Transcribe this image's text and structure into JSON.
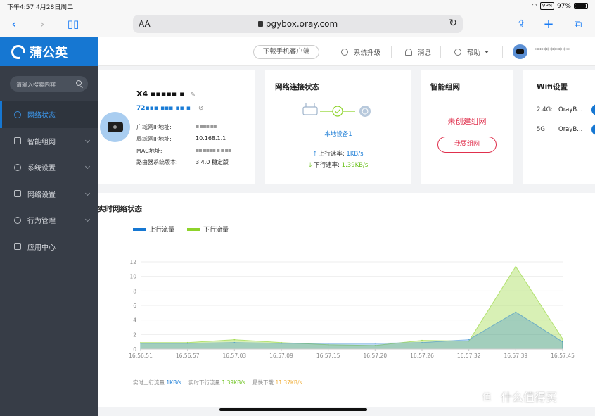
{
  "status_bar": {
    "time_date": "下午4:57   4月28日周二",
    "vpn": "VPN",
    "battery": "97%"
  },
  "browser": {
    "aa": "AA",
    "url": "pgybox.oray.com"
  },
  "sidebar": {
    "brand": "蒲公英",
    "search_placeholder": "请输入搜索内容",
    "items": [
      {
        "label": "网络状态",
        "active": true
      },
      {
        "label": "智能组网"
      },
      {
        "label": "系统设置"
      },
      {
        "label": "网络设置"
      },
      {
        "label": "行为管理"
      },
      {
        "label": "应用中心"
      }
    ]
  },
  "header": {
    "download": "下载手机客户端",
    "upgrade": "系统升级",
    "messages": "消息",
    "help": "帮助",
    "user": "*** ** ** ** * *"
  },
  "device_card": {
    "name": "X4 ▪▪▪▪▪ ▪",
    "id": "72▪▪▪ ▪▪▪ ▪▪ ▪",
    "labels": [
      "广域网IP地址:",
      "局域网IP地址:",
      "MAC地址:",
      "路由器系统版本:"
    ],
    "values": [
      "▪  ▪▪▪   ▪▪",
      "10.168.1.1",
      "▪▪  ▪▪▪▪  ▪ ▪ ▪▪",
      "3.4.0 稳定版"
    ]
  },
  "net_card": {
    "title": "网络连接状态",
    "device": "本地设备1",
    "up_label": "上行速率:",
    "up_value": "1KB/s",
    "down_label": "下行速率:",
    "down_value": "1.39KB/s"
  },
  "group_card": {
    "title": "智能组网",
    "status": "未创建组网",
    "button": "我要组网"
  },
  "wifi_card": {
    "title": "Wifi设置",
    "rows": [
      {
        "band": "2.4G:",
        "ssid": "OrayB..."
      },
      {
        "band": "5G:",
        "ssid": "OrayB..."
      }
    ]
  },
  "realtime": {
    "title": "实时网络状态",
    "legend_up": "上行流量",
    "legend_down": "下行流量",
    "footer_up_label": "实时上行流量",
    "footer_up_value": "1KB/s",
    "footer_down_label": "实时下行流量",
    "footer_down_value": "1.39KB/s",
    "footer_peak_label": "最快下载",
    "footer_peak_value": "11.37KB/s"
  },
  "colors": {
    "brand": "#1677d2",
    "up": "#1677d2",
    "down": "#8ed32b",
    "alert": "#e0304d"
  },
  "chart_data": {
    "type": "area",
    "x": [
      "16:56:51",
      "16:56:57",
      "16:57:03",
      "16:57:09",
      "16:57:15",
      "16:57:20",
      "16:57:26",
      "16:57:32",
      "16:57:39",
      "16:57:45"
    ],
    "yticks": [
      0,
      2,
      4,
      6,
      8,
      10,
      12
    ],
    "ylim": [
      0,
      12
    ],
    "series": [
      {
        "name": "上行流量",
        "values": [
          0.8,
          0.8,
          0.9,
          0.8,
          0.8,
          0.8,
          0.9,
          1.3,
          5.1,
          1.0
        ]
      },
      {
        "name": "下行流量",
        "values": [
          0.9,
          0.9,
          1.3,
          0.9,
          0.6,
          0.5,
          1.2,
          1.1,
          11.37,
          1.4
        ]
      }
    ]
  },
  "watermark": {
    "logo": "值",
    "text": "什么值得买"
  }
}
